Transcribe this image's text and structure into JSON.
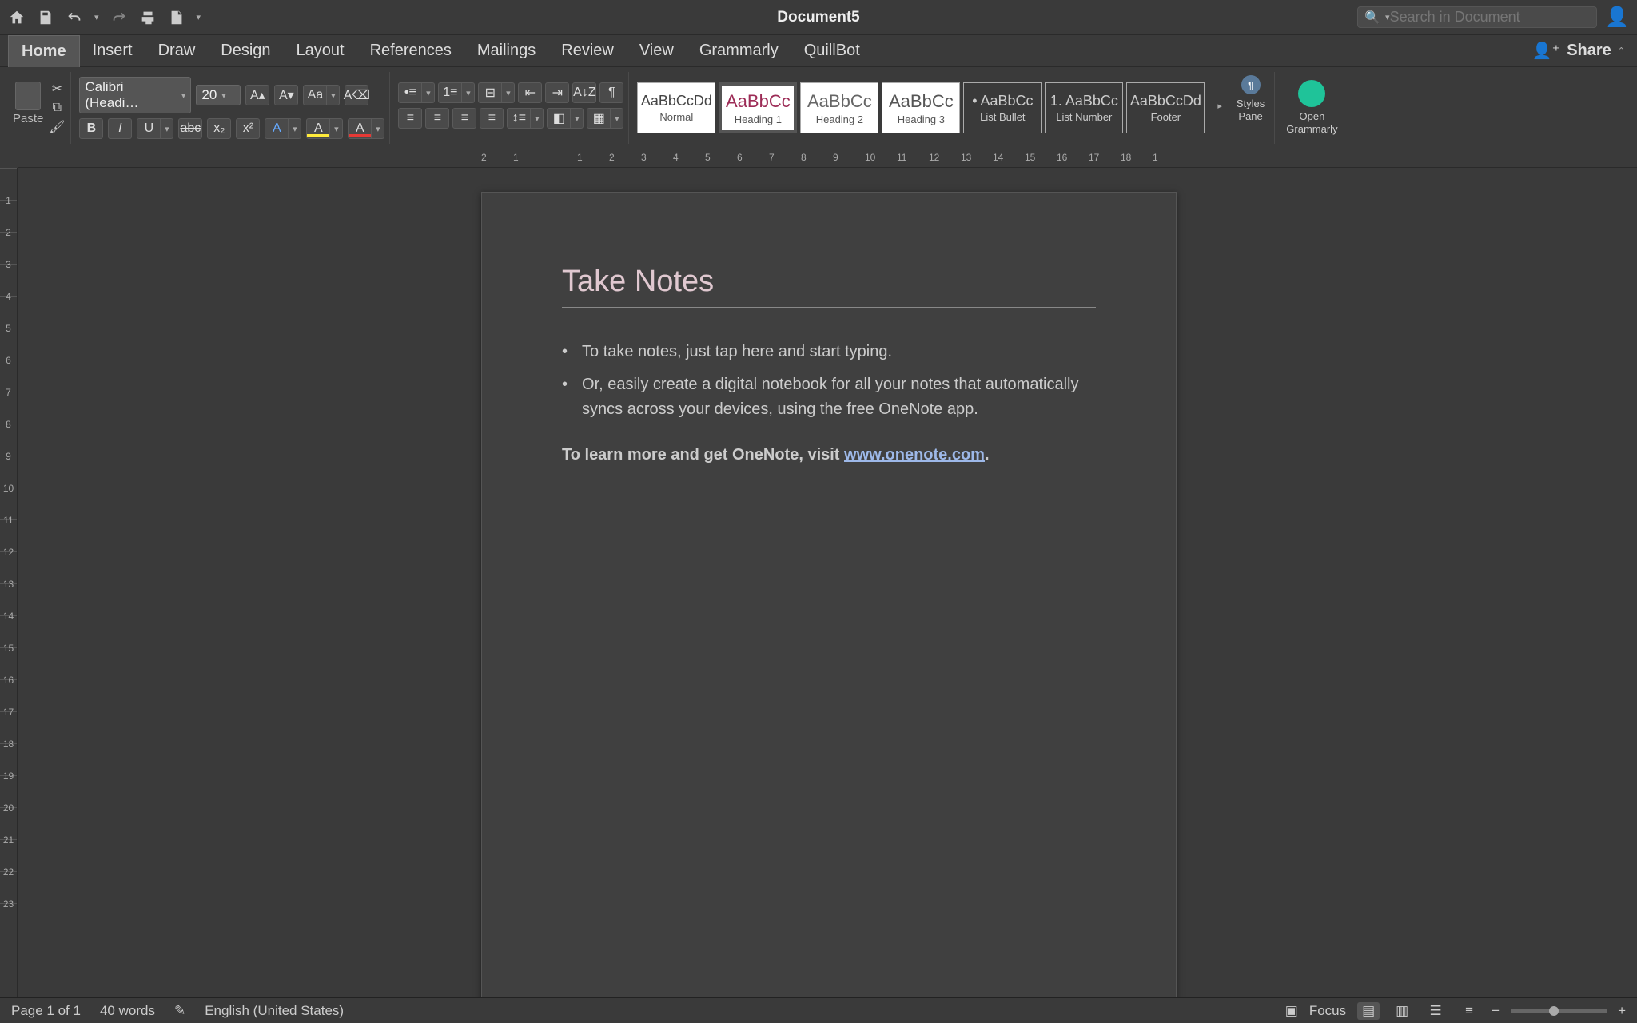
{
  "title_bar": {
    "document_title": "Document5",
    "search_placeholder": "Search in Document"
  },
  "tabs": {
    "items": [
      "Home",
      "Insert",
      "Draw",
      "Design",
      "Layout",
      "References",
      "Mailings",
      "Review",
      "View",
      "Grammarly",
      "QuillBot"
    ],
    "active": "Home",
    "share_label": "Share"
  },
  "ribbon": {
    "paste_label": "Paste",
    "font_name": "Calibri (Headi…",
    "font_size": "20",
    "styles": [
      {
        "preview": "AaBbCcDd",
        "label": "Normal",
        "cls": ""
      },
      {
        "preview": "AaBbCc",
        "label": "Heading 1",
        "cls": "h1"
      },
      {
        "preview": "AaBbCc",
        "label": "Heading 2",
        "cls": "h2"
      },
      {
        "preview": "AaBbCc",
        "label": "Heading 3",
        "cls": "h3"
      },
      {
        "preview": "AaBbCc",
        "label": "List Bullet",
        "cls": ""
      },
      {
        "preview": "AaBbCc",
        "label": "List Number",
        "cls": ""
      },
      {
        "preview": "AaBbCcDd",
        "label": "Footer",
        "cls": ""
      }
    ],
    "styles_pane_label": "Styles\nPane",
    "grammarly_label": "Open\nGrammarly"
  },
  "document": {
    "heading": "Take Notes",
    "bullets": [
      "To take notes, just tap here and start typing.",
      "Or, easily create a digital notebook for all your notes that automatically syncs across your devices, using the free OneNote app."
    ],
    "footer_prefix": "To learn more and get OneNote, visit ",
    "footer_link": "www.onenote.com",
    "footer_suffix": "."
  },
  "status": {
    "page": "Page 1 of 1",
    "words": "40 words",
    "language": "English (United States)",
    "focus": "Focus"
  },
  "ruler_h": [
    "2",
    "1",
    "",
    "1",
    "2",
    "3",
    "4",
    "5",
    "6",
    "7",
    "8",
    "9",
    "10",
    "11",
    "12",
    "13",
    "14",
    "15",
    "16",
    "17",
    "18",
    "1"
  ],
  "ruler_v": [
    "",
    "1",
    "2",
    "3",
    "4",
    "5",
    "6",
    "7",
    "8",
    "9",
    "10",
    "11",
    "12",
    "13",
    "14",
    "15",
    "16",
    "17",
    "18",
    "19",
    "20",
    "21",
    "22",
    "23"
  ]
}
